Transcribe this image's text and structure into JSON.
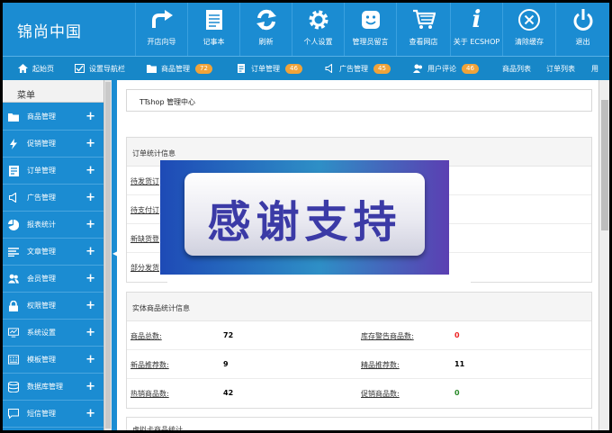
{
  "logo": "锦尚中国",
  "toolbar": [
    {
      "label": "开店向导",
      "icon": "arrow-turn-icon"
    },
    {
      "label": "记事本",
      "icon": "notepad-icon"
    },
    {
      "label": "刷新",
      "icon": "refresh-icon"
    },
    {
      "label": "个人设置",
      "icon": "gear-icon"
    },
    {
      "label": "管理员留言",
      "icon": "smile-message-icon"
    },
    {
      "label": "查看网店",
      "icon": "cart-icon"
    },
    {
      "label": "关于 ECSHOP",
      "icon": "info-icon"
    },
    {
      "label": "清除缓存",
      "icon": "clear-cache-icon"
    },
    {
      "label": "退出",
      "icon": "power-icon"
    }
  ],
  "nav": [
    {
      "label": "起始页",
      "icon": "home-icon"
    },
    {
      "label": "设置导航栏",
      "icon": "checkbox-icon"
    },
    {
      "label": "商品管理",
      "badge": "72",
      "icon": "folder-icon"
    },
    {
      "label": "订单管理",
      "badge": "46",
      "icon": "order-icon"
    },
    {
      "label": "广告管理",
      "badge": "45",
      "icon": "speaker-icon"
    },
    {
      "label": "用户评论",
      "badge": "46",
      "icon": "users-icon"
    },
    {
      "label": "商品列表"
    },
    {
      "label": "订单列表"
    },
    {
      "label": "用"
    }
  ],
  "sidebar": {
    "title": "菜单",
    "items": [
      {
        "label": "商品管理",
        "icon": "folder-icon"
      },
      {
        "label": "促销管理",
        "icon": "lightning-icon"
      },
      {
        "label": "订单管理",
        "icon": "order-icon"
      },
      {
        "label": "广告管理",
        "icon": "speaker-icon"
      },
      {
        "label": "报表统计",
        "icon": "pie-chart-icon"
      },
      {
        "label": "文章管理",
        "icon": "list-icon"
      },
      {
        "label": "会员管理",
        "icon": "users-icon"
      },
      {
        "label": "权限管理",
        "icon": "lock-icon"
      },
      {
        "label": "系统设置",
        "icon": "monitor-icon"
      },
      {
        "label": "模板管理",
        "icon": "template-icon"
      },
      {
        "label": "数据库管理",
        "icon": "database-icon"
      },
      {
        "label": "短信管理",
        "icon": "sms-icon"
      }
    ]
  },
  "content": {
    "breadcrumb": "TTshop 管理中心",
    "order_panel": {
      "title": "订单统计信息",
      "rows": [
        "待发货订",
        "待支付订",
        "新缺货登",
        "部分发货"
      ]
    },
    "goods_panel": {
      "title": "实体商品统计信息",
      "rows": [
        {
          "l1": "商品总数:",
          "v1": "72",
          "l2": "库存警告商品数:",
          "v2": "0"
        },
        {
          "l1": "新品推荐数:",
          "v1": "9",
          "l2": "精品推荐数:",
          "v2": "11"
        },
        {
          "l1": "热销商品数:",
          "v1": "42",
          "l2": "促销商品数:",
          "v2": "0"
        }
      ]
    },
    "next_panel_title": "虚拟卡商品统计"
  },
  "overlay_text": "感谢支持"
}
